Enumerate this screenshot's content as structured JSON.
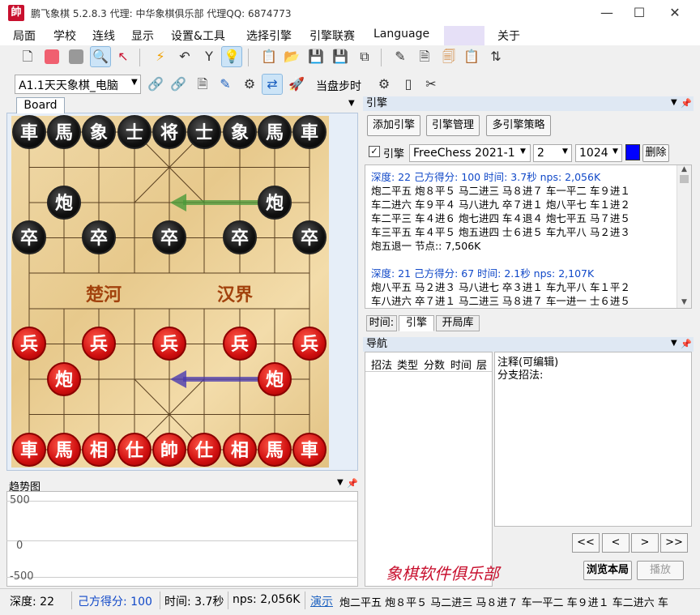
{
  "window": {
    "icon_char": "帥",
    "title": "鹏飞象棋 5.2.8.3   代理: 中华象棋俱乐部   代理QQ: 6874773",
    "minimize": "—",
    "maximize": "☐",
    "close": "✕"
  },
  "menu": [
    "局面",
    "学校",
    "连线",
    "显示",
    "设置&工具",
    "选择引擎",
    "引擎联赛",
    "Language",
    "关于"
  ],
  "toolbar2": {
    "game_select": "A1.1天天象棋_电脑",
    "sync_label": "当盘步时"
  },
  "board": {
    "tab_label": "Board",
    "river_left": "楚河",
    "river_right": "汉界",
    "black_row0": [
      "車",
      "馬",
      "象",
      "士",
      "将",
      "士",
      "象",
      "馬",
      "車"
    ],
    "black_cannon": "炮",
    "black_pawn": "卒",
    "red_pawn": "兵",
    "red_cannon": "炮",
    "red_row9": [
      "車",
      "馬",
      "相",
      "仕",
      "帥",
      "仕",
      "相",
      "馬",
      "車"
    ]
  },
  "trend": {
    "title": "趋势图",
    "y_top": "500",
    "y_mid": "0",
    "y_bottom": "-500"
  },
  "engine": {
    "title": "引擎",
    "add_engine": "添加引擎",
    "manage_engine": "引擎管理",
    "multi_engine": "多引擎策略",
    "enable_label": "引擎",
    "engine_name": "FreeChess  2021-1",
    "threads": "2",
    "hash": "1024",
    "delete": "删除",
    "accent_color": "#0000ff",
    "analysis": [
      {
        "text": "深度: 22  己方得分: 100  时间: 3.7秒  nps: 2,056K",
        "blue": true
      },
      {
        "text": "炮二平五  炮８平５  马二进三  马８进７  车一平二  车９进１",
        "blue": false
      },
      {
        "text": "车二进六  车９平４  马八进九  卒７进１  炮八平七  车１进２",
        "blue": false
      },
      {
        "text": "车二平三  车４进６  炮七进四  车４退４  炮七平五  马７进５",
        "blue": false
      },
      {
        "text": "车三平五  车４平５  炮五进四  士６进５  车九平八  马２进３",
        "blue": false
      },
      {
        "text": "炮五退一   节点:: 7,506K",
        "blue": false
      },
      {
        "text": "",
        "blue": false
      },
      {
        "text": "深度: 21  己方得分: 67  时间: 2.1秒  nps: 2,107K",
        "blue": true
      },
      {
        "text": "炮八平五  马２进３  马八进七  卒３进１  车九平八  车１平２",
        "blue": false
      },
      {
        "text": "车八进六  卒７进１  马二进三  马８进７  车一进一  士６进５",
        "blue": false
      }
    ],
    "tabs": [
      "时间:",
      "引擎",
      "开局库"
    ]
  },
  "nav": {
    "title": "导航",
    "columns": [
      "招法",
      "类型",
      "分数",
      "时间",
      "层"
    ],
    "comment_title": "注释(可编辑)",
    "branch_label": "分支招法:",
    "btn_first": "<<",
    "btn_prev": "<",
    "btn_next": ">",
    "btn_last": ">>",
    "browse": "浏览本局",
    "play": "播放",
    "club": "象棋软件俱乐部"
  },
  "status": {
    "depth": "深度: 22",
    "score": "己方得分: 100",
    "time": "时间: 3.7秒",
    "nps": "nps: 2,056K",
    "demo": "演示",
    "pv": "炮二平五  炮８平５  马二进三  马８进７  车一平二  车９进１  车二进六  车"
  }
}
